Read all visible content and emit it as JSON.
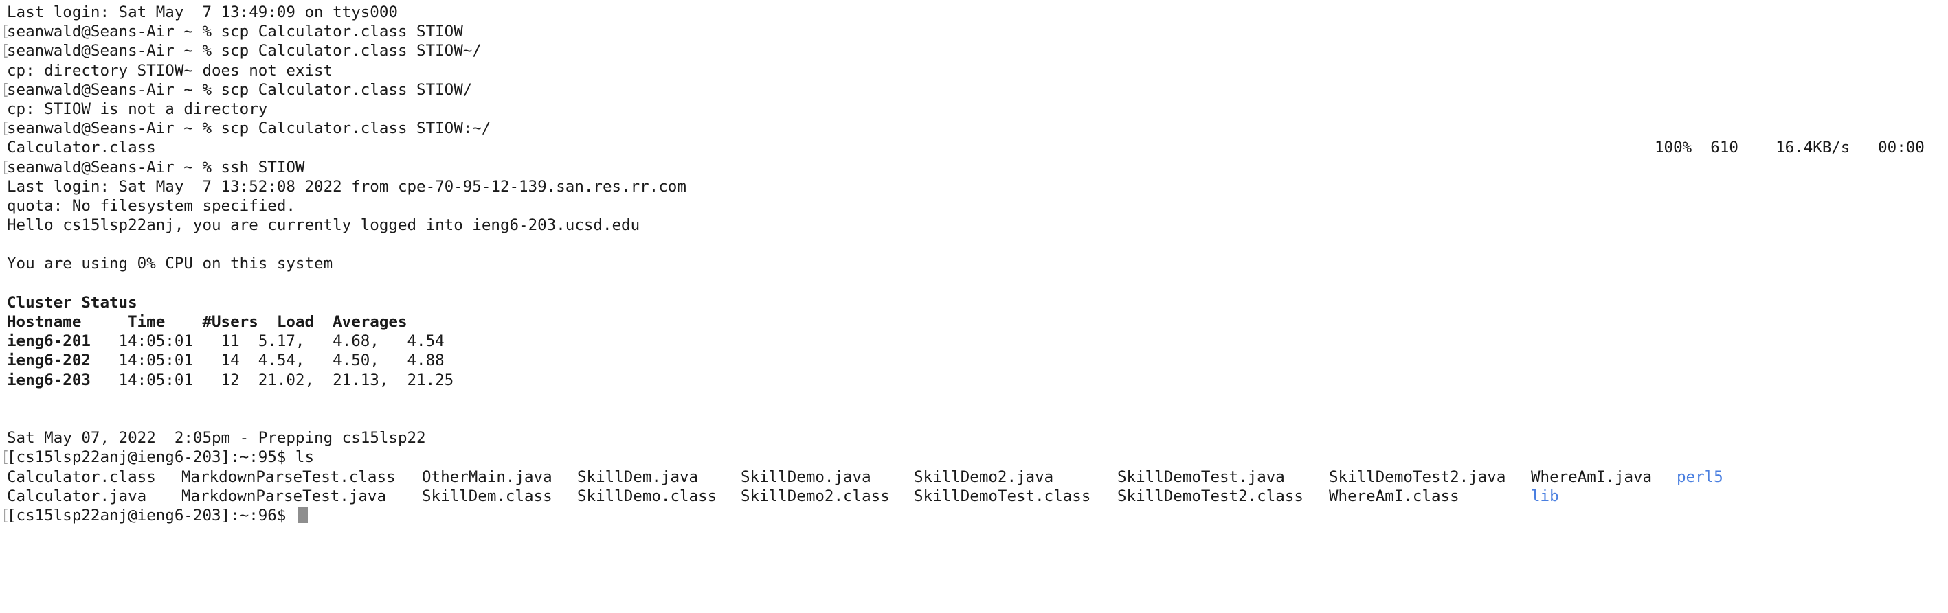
{
  "terminal": {
    "line_last_login_1": "Last login: Sat May  7 13:49:09 on ttys000",
    "line_cmd_1": "seanwald@Seans-Air ~ % scp Calculator.class STIOW",
    "line_cmd_2": "seanwald@Seans-Air ~ % scp Calculator.class STIOW~/",
    "line_err_1": "cp: directory STIOW~ does not exist",
    "line_cmd_3": "seanwald@Seans-Air ~ % scp Calculator.class STIOW/",
    "line_err_2": "cp: STIOW is not a directory",
    "line_cmd_4": "seanwald@Seans-Air ~ % scp Calculator.class STIOW:~/",
    "transfer": {
      "file": "Calculator.class",
      "stats": "100%  610    16.4KB/s   00:00"
    },
    "line_cmd_5": "seanwald@Seans-Air ~ % ssh STIOW",
    "line_last_login_2": "Last login: Sat May  7 13:52:08 2022 from cpe-70-95-12-139.san.res.rr.com",
    "line_quota": "quota: No filesystem specified.",
    "line_hello": "Hello cs15lsp22anj, you are currently logged into ieng6-203.ucsd.edu",
    "line_cpu": "You are using 0% CPU on this system",
    "cluster": {
      "title": "Cluster Status",
      "header": "Hostname     Time    #Users  Load  Averages",
      "rows": [
        {
          "host": "ieng6-201",
          "rest": "   14:05:01   11  5.17,   4.68,   4.54"
        },
        {
          "host": "ieng6-202",
          "rest": "   14:05:01   14  4.54,   4.50,   4.88"
        },
        {
          "host": "ieng6-203",
          "rest": "   14:05:01   12  21.02,  21.13,  21.25"
        }
      ]
    },
    "line_date": "Sat May 07, 2022  2:05pm - Prepping cs15lsp22",
    "line_prompt_ls": "[cs15lsp22anj@ieng6-203]:~:95$ ls",
    "ls_row1": [
      "Calculator.class",
      "MarkdownParseTest.class",
      "OtherMain.java",
      "SkillDem.java",
      "SkillDemo.java",
      "SkillDemo2.java",
      "SkillDemoTest.java",
      "SkillDemoTest2.java",
      "WhereAmI.java",
      "perl5"
    ],
    "ls_row2": [
      "Calculator.java",
      "MarkdownParseTest.java",
      "SkillDem.class",
      "SkillDemo.class",
      "SkillDemo2.class",
      "SkillDemoTest.class",
      "SkillDemoTest2.class",
      "WhereAmI.class",
      "lib"
    ],
    "line_prompt_final": "[cs15lsp22anj@ieng6-203]:~:96$ ",
    "left_marker": "[",
    "dir_color": "#4a7fe0"
  }
}
